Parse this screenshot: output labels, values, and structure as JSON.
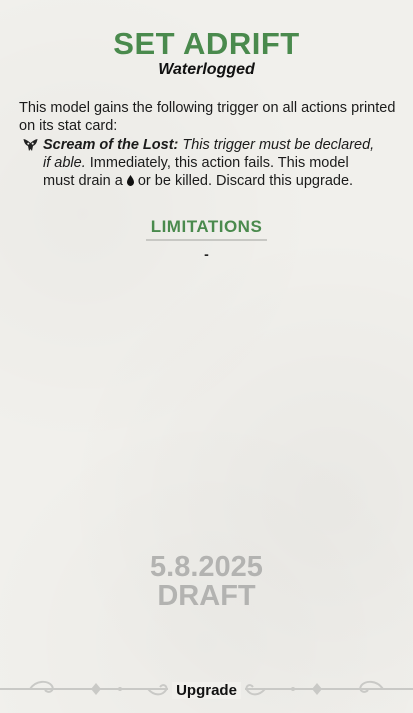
{
  "card": {
    "title": "SET ADRIFT",
    "subtitle": "Waterlogged",
    "rules_text": "This model gains the following trigger on all actions printed on its stat card:",
    "trigger": {
      "icon": "mask-icon",
      "name": "Scream of the Lost:",
      "condition": "This trigger must be declared, if able.",
      "effect_before_icon": "Immediately, this action fails. This model must drain a",
      "effect_icon": "soulstone-drop-icon",
      "effect_after_icon": "or be killed. Discard this upgrade."
    },
    "limitations": {
      "heading": "LIMITATIONS",
      "value": "-"
    },
    "watermark": {
      "line1": "5.8.2025",
      "line2": "DRAFT"
    },
    "footer": {
      "label": "Upgrade"
    }
  },
  "colors": {
    "accent": "#4a8a4d",
    "watermark": "#b3b3b1",
    "background": "#f1f0ec"
  }
}
